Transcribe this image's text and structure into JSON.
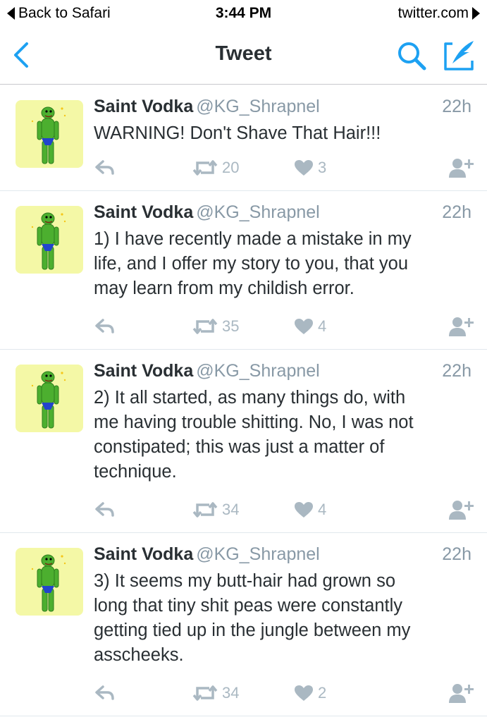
{
  "status_bar": {
    "back_label": "Back to Safari",
    "time": "3:44 PM",
    "domain": "twitter.com"
  },
  "nav": {
    "title": "Tweet",
    "back_icon": "chevron-left-icon",
    "search_icon": "search-icon",
    "compose_icon": "compose-icon"
  },
  "colors": {
    "accent": "#1da1f2",
    "text": "#292f33",
    "muted": "#8899a6",
    "action_gray": "#aab8c2",
    "avatar_bg": "#f4f8a6"
  },
  "tweets": [
    {
      "name": "Saint Vodka",
      "handle": "@KG_Shrapnel",
      "time": "22h",
      "lines": [
        "WARNING! Don't Shave That Hair!!!"
      ],
      "retweets": "20",
      "likes": "3"
    },
    {
      "name": "Saint Vodka",
      "handle": "@KG_Shrapnel",
      "time": "22h",
      "lines": [
        "1) I have recently made a mistake in my",
        "life, and I offer my story to you, that you",
        "may learn from my childish error."
      ],
      "retweets": "35",
      "likes": "4"
    },
    {
      "name": "Saint Vodka",
      "handle": "@KG_Shrapnel",
      "time": "22h",
      "lines": [
        "2) It all started, as many things do, with",
        "me having trouble shitting. No, I was not",
        "constipated; this was just a matter of",
        "technique."
      ],
      "retweets": "34",
      "likes": "4"
    },
    {
      "name": "Saint Vodka",
      "handle": "@KG_Shrapnel",
      "time": "22h",
      "lines": [
        "3) It seems my butt-hair had grown so",
        "long that tiny shit peas were constantly",
        "getting tied up in the jungle between my",
        "asscheeks."
      ],
      "retweets": "34",
      "likes": "2"
    }
  ]
}
